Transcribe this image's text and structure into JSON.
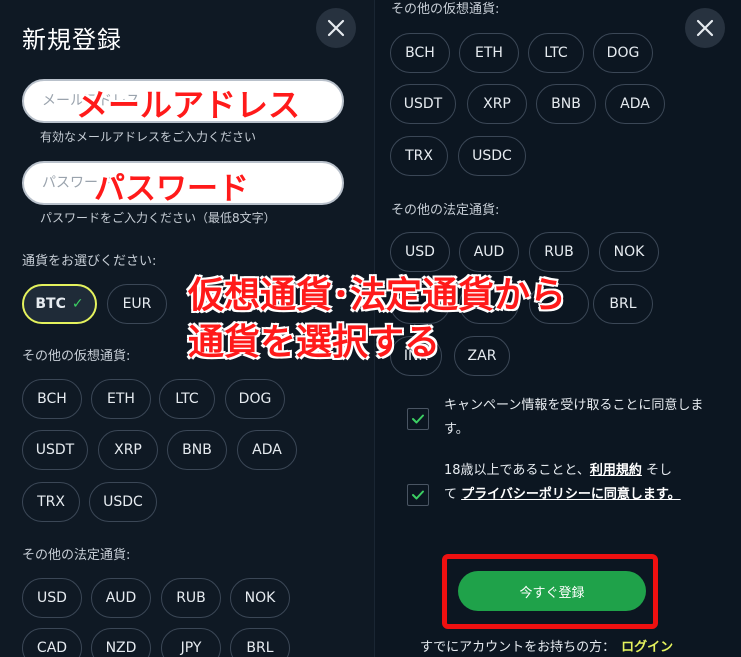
{
  "left": {
    "title": "新規登録",
    "email": {
      "placeholder": "メールアドレス",
      "hint": "有効なメールアドレスをご入力ください"
    },
    "password": {
      "placeholder": "パスワード",
      "hint": "パスワードをご入力ください（最低8文字）"
    },
    "currency_label": "通貨をお選びください:",
    "primary_currencies": [
      "BTC",
      "EUR"
    ],
    "selected_currency": "BTC",
    "crypto_label": "その他の仮想通貨:",
    "crypto": [
      "BCH",
      "ETH",
      "LTC",
      "DOG",
      "USDT",
      "XRP",
      "BNB",
      "ADA",
      "TRX",
      "USDC"
    ],
    "fiat_label": "その他の法定通貨:",
    "fiat": [
      "USD",
      "AUD",
      "RUB",
      "NOK",
      "CAD",
      "NZD",
      "JPY",
      "BRL"
    ]
  },
  "right": {
    "crypto_label": "その他の仮想通貨:",
    "crypto": [
      "BCH",
      "ETH",
      "LTC",
      "DOG",
      "USDT",
      "XRP",
      "BNB",
      "ADA",
      "TRX",
      "USDC"
    ],
    "fiat_label": "その他の法定通貨:",
    "fiat": [
      "USD",
      "AUD",
      "RUB",
      "NOK",
      "BRL",
      "INR",
      "ZAR"
    ],
    "consent_campaign": "キャンペーン情報を受け取ることに同意します。",
    "consent_terms_prefix": "18歳以上であることと、",
    "consent_terms_link": "利用規約",
    "consent_terms_middle": " そして ",
    "consent_privacy_link": "プライバシーポリシーに同意します。",
    "register_button": "今すぐ登録",
    "login_prompt": "すでにアカウントをお持ちの方：",
    "login_link": "ログイン"
  },
  "annotations": {
    "email": "メールアドレス",
    "password": "パスワード",
    "currency_line1": "仮想通貨･法定通貨から",
    "currency_line2": "通貨を選択する"
  },
  "colors": {
    "background": "#0f1924",
    "accent_yellow": "#e4f25d",
    "button_green": "#1fa24a",
    "check_green": "#3ccf63",
    "annotation_red": "#ff1a1a"
  }
}
